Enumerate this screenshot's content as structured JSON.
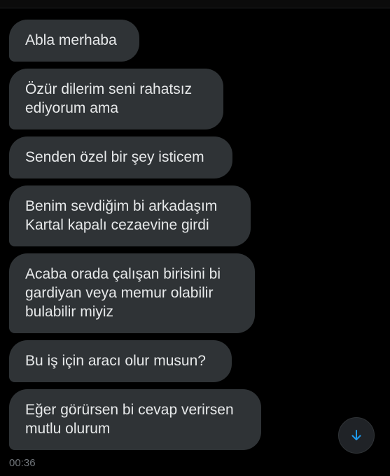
{
  "messages": [
    {
      "text": "Abla merhaba"
    },
    {
      "text": "Özür dilerim seni rahatsız ediyorum ama"
    },
    {
      "text": "Senden özel bir şey isticem"
    },
    {
      "text": "Benim sevdiğim bi arkadaşım Kartal kapalı cezaevine girdi"
    },
    {
      "text": "Acaba orada çalışan birisini bi gardiyan veya memur olabilir bulabilir miyiz"
    },
    {
      "text": "Bu iş için aracı olur musun?"
    },
    {
      "text": "Eğer görürsen bi cevap verirsen mutlu olurum"
    }
  ],
  "timestamp": "00:36",
  "scroll_button": {
    "icon": "arrow-down-icon"
  },
  "colors": {
    "background": "#000000",
    "bubble": "#2f3336",
    "text": "#e7e9ea",
    "muted": "#71767b",
    "accent": "#1d9bf0"
  }
}
